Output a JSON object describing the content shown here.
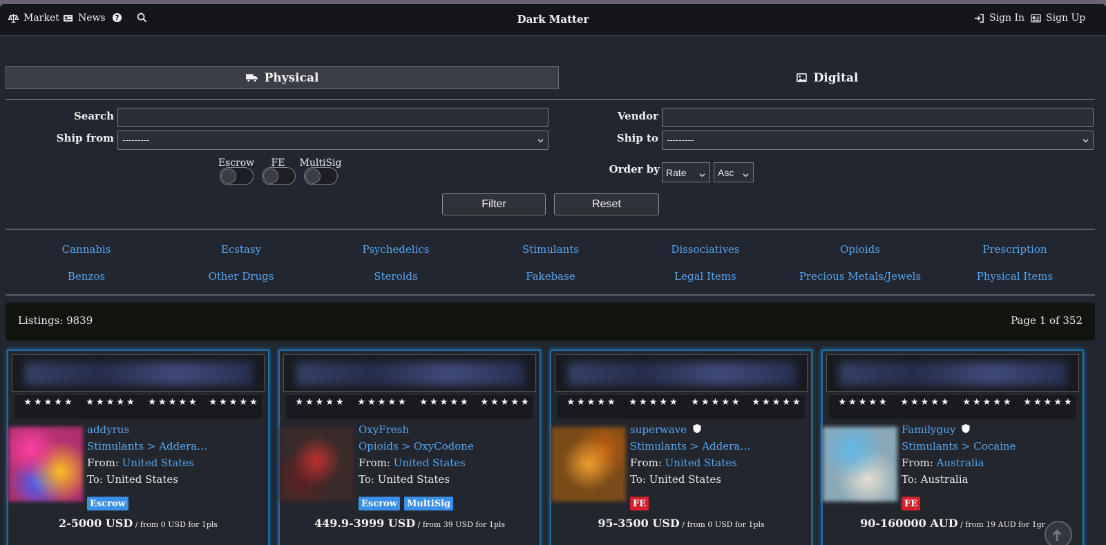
{
  "nav": {
    "market": "Market",
    "news": "News",
    "title": "Dark Matter",
    "sign_in": "Sign In",
    "sign_up": "Sign Up"
  },
  "tabs": {
    "physical": "Physical",
    "digital": "Digital"
  },
  "filters": {
    "search_label": "Search",
    "search_value": "",
    "vendor_label": "Vendor",
    "vendor_value": "",
    "ship_from_label": "Ship from",
    "ship_from_value": "---------",
    "ship_to_label": "Ship to",
    "ship_to_value": "---------",
    "escrow_label": "Escrow",
    "fe_label": "FE",
    "multisig_label": "MultiSig",
    "order_by_label": "Order by",
    "order_by_value": "Rate",
    "order_dir_value": "Asc",
    "filter_button": "Filter",
    "reset_button": "Reset"
  },
  "categories": [
    "Cannabis",
    "Ecstasy",
    "Psychedelics",
    "Stimulants",
    "Dissociatives",
    "Opioids",
    "Prescription",
    "Benzos",
    "Other Drugs",
    "Steroids",
    "Fakebase",
    "Legal Items",
    "Precious Metals/Jewels",
    "Physical Items"
  ],
  "listing_bar": {
    "count": "Listings: 9839",
    "page": "Page 1 of 352"
  },
  "cards": [
    {
      "vendor": "addyrus",
      "category": "Stimulants > Addera…",
      "from_label": "From: ",
      "from": "United States",
      "to": "To: United States",
      "badges": [
        "Escrow"
      ],
      "price": "2-5000 USD",
      "price_note": " / from 0 USD for 1pls",
      "verified": false
    },
    {
      "vendor": "OxyFresh",
      "category": "Opioids > OxyCodone",
      "from_label": "From: ",
      "from": "United States",
      "to": "To: United States",
      "badges": [
        "Escrow",
        "MultiSig"
      ],
      "price": "449.9-3999 USD",
      "price_note": " / from 39 USD for 1pls",
      "verified": false
    },
    {
      "vendor": "superwave",
      "category": "Stimulants > Addera…",
      "from_label": "From: ",
      "from": "United States",
      "to": "To: United States",
      "badges": [
        "FE"
      ],
      "price": "95-3500 USD",
      "price_note": " / from 0 USD for 1pls",
      "verified": true
    },
    {
      "vendor": "Familyguy",
      "category": "Stimulants > Cocaine",
      "from_label": "From: ",
      "from": "Australia",
      "to": "To: Australia",
      "badges": [
        "FE"
      ],
      "price": "90-160000 AUD",
      "price_note": " / from 19 AUD for 1gr",
      "verified": true
    }
  ],
  "star_glyphs": "★★★★★",
  "colors": {
    "link": "#58a6f0",
    "escrow": "#3a8fe8",
    "fe": "#d61f2c",
    "card_border": "#1e6fa7"
  }
}
